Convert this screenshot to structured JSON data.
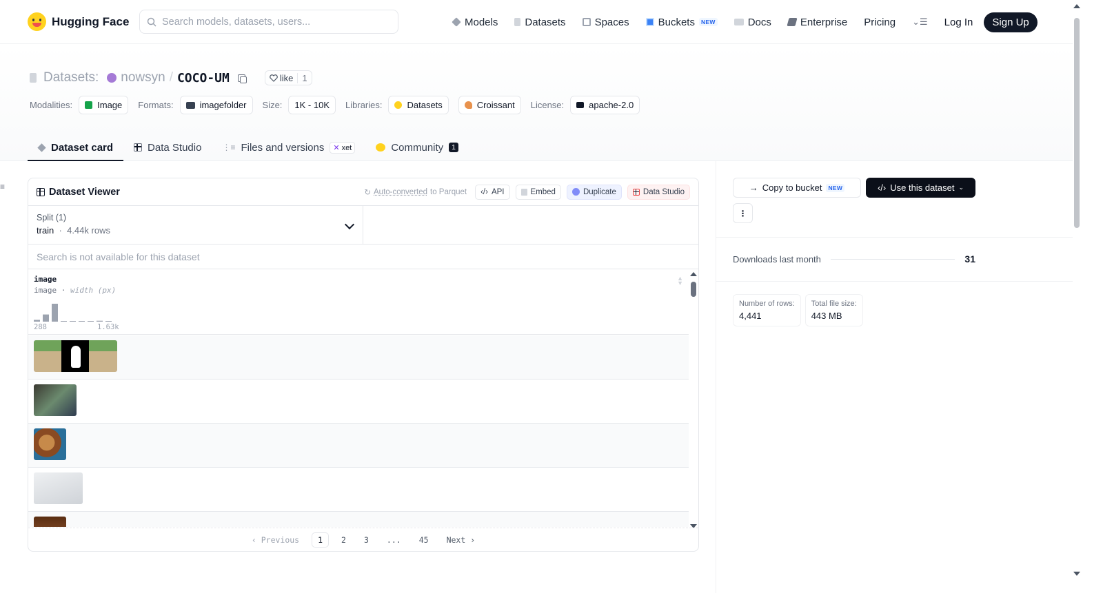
{
  "nav": {
    "brand": "Hugging Face",
    "search_placeholder": "Search models, datasets, users...",
    "items": [
      {
        "label": "Models",
        "icon": "cube-icon",
        "color": "#9ca3af"
      },
      {
        "label": "Datasets",
        "icon": "database-icon",
        "color": "#d1d5db"
      },
      {
        "label": "Spaces",
        "icon": "grid-icon",
        "color": "#9ca3af"
      },
      {
        "label": "Buckets",
        "icon": "bucket-icon",
        "color": "#3b82f6",
        "badge": "NEW"
      },
      {
        "label": "Docs",
        "icon": "book-icon",
        "color": "#9ca3af"
      },
      {
        "label": "Enterprise",
        "icon": "enterprise-icon",
        "color": "#6b7280"
      },
      {
        "label": "Pricing"
      }
    ],
    "login": "Log In",
    "signup": "Sign Up"
  },
  "header": {
    "section": "Datasets:",
    "owner": "nowsyn",
    "repo": "COCO-UM",
    "like_label": "like",
    "like_count": "1",
    "meta": {
      "modalities_label": "Modalities:",
      "modality": "Image",
      "formats_label": "Formats:",
      "format": "imagefolder",
      "size_label": "Size:",
      "size": "1K - 10K",
      "libraries_label": "Libraries:",
      "libraries": [
        "Datasets",
        "Croissant"
      ],
      "license_label": "License:",
      "license": "apache-2.0"
    },
    "tabs": [
      {
        "label": "Dataset card",
        "active": true
      },
      {
        "label": "Data Studio"
      },
      {
        "label": "Files and versions",
        "badge": "xet"
      },
      {
        "label": "Community",
        "count": "1"
      }
    ]
  },
  "viewer": {
    "title": "Dataset Viewer",
    "auto_converted_prefix": "Auto-converted",
    "auto_converted_suffix": " to Parquet",
    "actions": [
      "API",
      "Embed",
      "Duplicate",
      "Data Studio"
    ],
    "split_label": "Split (1)",
    "split_name": "train",
    "split_rows": "4.44k rows",
    "search_disabled": "Search is not available for this dataset",
    "column": {
      "name": "image",
      "type": "image",
      "stat": "width (px)",
      "hist_min": "288",
      "hist_max": "1.63k",
      "hist_values": [
        0.1,
        0.4,
        1.0,
        0.03,
        0.02,
        0.02,
        0.02,
        0.05,
        0.02
      ]
    },
    "pagination": {
      "previous": "Previous",
      "pages": [
        "1",
        "2",
        "3",
        "...",
        "45"
      ],
      "current": "1",
      "next": "Next"
    }
  },
  "sidebar": {
    "copy_to_bucket": "Copy to bucket",
    "copy_badge": "NEW",
    "use_dataset": "Use this dataset",
    "downloads_label": "Downloads last month",
    "downloads_value": "31",
    "rows_label": "Number of rows:",
    "rows_value": "4,441",
    "size_label": "Total file size:",
    "size_value": "443 MB"
  },
  "colors": {
    "accent": "#111827",
    "buckets_badge": "#2563eb",
    "logo": "#ffd21e"
  }
}
